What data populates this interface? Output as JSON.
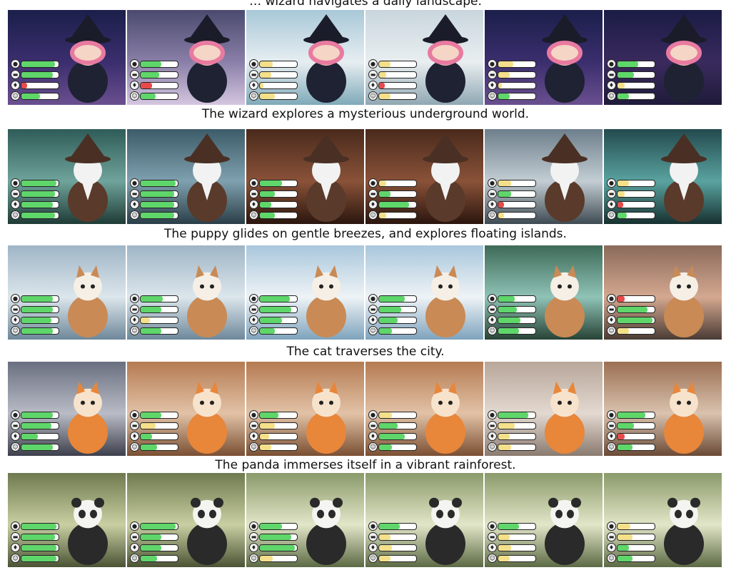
{
  "captions": [
    "… wizard navigates a daily landscape.",
    "The wizard explores a mysterious underground world.",
    "The puppy glides on gentle breezes, and explores floating islands.",
    "The cat traverses the city.",
    "The panda immerses itself in a vibrant rainforest."
  ],
  "stat_icons": [
    "food-icon",
    "energy-icon",
    "health-icon",
    "mood-icon"
  ],
  "stat_glyphs": [
    "●",
    "▬",
    "♦",
    "☺"
  ],
  "colors": {
    "high": "#5fd66a",
    "low_yellow": "#f4e08a",
    "low_red": "#e84a4a"
  },
  "rows": [
    {
      "subject": "witch",
      "scenes": [
        "starry-night",
        "misty-forest",
        "waterfall-castle",
        "mountain-lake",
        "starry-night",
        "halloween-night"
      ],
      "stats": [
        [
          {
            "v": 0.9,
            "c": "high"
          },
          {
            "v": 0.85,
            "c": "high"
          },
          {
            "v": 0.15,
            "c": "low_red"
          },
          {
            "v": 0.5,
            "c": "high"
          }
        ],
        [
          {
            "v": 0.55,
            "c": "high"
          },
          {
            "v": 0.5,
            "c": "high"
          },
          {
            "v": 0.3,
            "c": "low_red"
          },
          {
            "v": 0.4,
            "c": "high"
          }
        ],
        [
          {
            "v": 0.35,
            "c": "low_yellow"
          },
          {
            "v": 0.3,
            "c": "low_yellow"
          },
          {
            "v": 0.1,
            "c": "low_yellow"
          },
          {
            "v": 0.4,
            "c": "low_yellow"
          }
        ],
        [
          {
            "v": 0.3,
            "c": "low_yellow"
          },
          {
            "v": 0.2,
            "c": "low_yellow"
          },
          {
            "v": 0.15,
            "c": "low_red"
          },
          {
            "v": 0.3,
            "c": "low_yellow"
          }
        ],
        [
          {
            "v": 0.4,
            "c": "low_yellow"
          },
          {
            "v": 0.3,
            "c": "low_yellow"
          },
          {
            "v": 0.1,
            "c": "low_yellow"
          },
          {
            "v": 0.3,
            "c": "high"
          }
        ],
        [
          {
            "v": 0.55,
            "c": "high"
          },
          {
            "v": 0.45,
            "c": "high"
          },
          {
            "v": 0.2,
            "c": "low_yellow"
          },
          {
            "v": 0.3,
            "c": "high"
          }
        ]
      ]
    },
    {
      "subject": "old-wizard",
      "scenes": [
        "forest-cliff",
        "twilight-forest",
        "cave-tunnel",
        "cave-tunnel",
        "castle-night",
        "glowing-forest"
      ],
      "stats": [
        [
          {
            "v": 0.95,
            "c": "high"
          },
          {
            "v": 0.9,
            "c": "high"
          },
          {
            "v": 0.85,
            "c": "high"
          },
          {
            "v": 0.9,
            "c": "high"
          }
        ],
        [
          {
            "v": 0.95,
            "c": "high"
          },
          {
            "v": 0.9,
            "c": "high"
          },
          {
            "v": 0.9,
            "c": "high"
          },
          {
            "v": 0.9,
            "c": "high"
          }
        ],
        [
          {
            "v": 0.6,
            "c": "high"
          },
          {
            "v": 0.4,
            "c": "high"
          },
          {
            "v": 0.3,
            "c": "high"
          },
          {
            "v": 0.4,
            "c": "high"
          }
        ],
        [
          {
            "v": 0.2,
            "c": "low_yellow"
          },
          {
            "v": 0.3,
            "c": "high"
          },
          {
            "v": 0.8,
            "c": "high"
          },
          {
            "v": 0.2,
            "c": "low_yellow"
          }
        ],
        [
          {
            "v": 0.35,
            "c": "low_yellow"
          },
          {
            "v": 0.35,
            "c": "high"
          },
          {
            "v": 0.15,
            "c": "low_red"
          },
          {
            "v": 0.15,
            "c": "low_yellow"
          }
        ],
        [
          {
            "v": 0.3,
            "c": "low_yellow"
          },
          {
            "v": 0.2,
            "c": "low_yellow"
          },
          {
            "v": 0.15,
            "c": "low_red"
          },
          {
            "v": 0.25,
            "c": "high"
          }
        ]
      ]
    },
    {
      "subject": "puppy",
      "scenes": [
        "sky-platform",
        "sky-platform",
        "cloud-sky",
        "cloud-sky",
        "waterfall-lake",
        "sunset-house"
      ],
      "stats": [
        [
          {
            "v": 0.85,
            "c": "high"
          },
          {
            "v": 0.85,
            "c": "high"
          },
          {
            "v": 0.8,
            "c": "high"
          },
          {
            "v": 0.85,
            "c": "high"
          }
        ],
        [
          {
            "v": 0.6,
            "c": "high"
          },
          {
            "v": 0.55,
            "c": "high"
          },
          {
            "v": 0.25,
            "c": "low_yellow"
          },
          {
            "v": 0.55,
            "c": "high"
          }
        ],
        [
          {
            "v": 0.8,
            "c": "high"
          },
          {
            "v": 0.85,
            "c": "high"
          },
          {
            "v": 0.6,
            "c": "high"
          },
          {
            "v": 0.4,
            "c": "high"
          }
        ],
        [
          {
            "v": 0.7,
            "c": "high"
          },
          {
            "v": 0.6,
            "c": "high"
          },
          {
            "v": 0.5,
            "c": "high"
          },
          {
            "v": 0.35,
            "c": "high"
          }
        ],
        [
          {
            "v": 0.45,
            "c": "high"
          },
          {
            "v": 0.5,
            "c": "high"
          },
          {
            "v": 0.6,
            "c": "high"
          },
          {
            "v": 0.55,
            "c": "high"
          }
        ],
        [
          {
            "v": 0.2,
            "c": "low_red"
          },
          {
            "v": 0.8,
            "c": "high"
          },
          {
            "v": 0.95,
            "c": "high"
          },
          {
            "v": 0.3,
            "c": "low_yellow"
          }
        ]
      ]
    },
    {
      "subject": "cat",
      "scenes": [
        "city-night",
        "alley-wall",
        "alley-wall",
        "alley-wall",
        "plain-room",
        "arch-room"
      ],
      "stats": [
        [
          {
            "v": 0.85,
            "c": "high"
          },
          {
            "v": 0.8,
            "c": "high"
          },
          {
            "v": 0.45,
            "c": "high"
          },
          {
            "v": 0.85,
            "c": "high"
          }
        ],
        [
          {
            "v": 0.55,
            "c": "high"
          },
          {
            "v": 0.4,
            "c": "low_yellow"
          },
          {
            "v": 0.3,
            "c": "high"
          },
          {
            "v": 0.45,
            "c": "high"
          }
        ],
        [
          {
            "v": 0.5,
            "c": "high"
          },
          {
            "v": 0.4,
            "c": "low_yellow"
          },
          {
            "v": 0.25,
            "c": "low_yellow"
          },
          {
            "v": 0.3,
            "c": "low_yellow"
          }
        ],
        [
          {
            "v": 0.35,
            "c": "low_yellow"
          },
          {
            "v": 0.5,
            "c": "high"
          },
          {
            "v": 0.7,
            "c": "high"
          },
          {
            "v": 0.35,
            "c": "high"
          }
        ],
        [
          {
            "v": 0.8,
            "c": "high"
          },
          {
            "v": 0.45,
            "c": "low_yellow"
          },
          {
            "v": 0.3,
            "c": "low_yellow"
          },
          {
            "v": 0.35,
            "c": "low_yellow"
          }
        ],
        [
          {
            "v": 0.75,
            "c": "high"
          },
          {
            "v": 0.45,
            "c": "high"
          },
          {
            "v": 0.2,
            "c": "low_red"
          },
          {
            "v": 0.4,
            "c": "high"
          }
        ]
      ]
    },
    {
      "subject": "panda",
      "scenes": [
        "rainforest",
        "rainforest",
        "jungle-light",
        "jungle-light",
        "jungle-light",
        "jungle-light"
      ],
      "stats": [
        [
          {
            "v": 0.95,
            "c": "high"
          },
          {
            "v": 0.9,
            "c": "high"
          },
          {
            "v": 0.95,
            "c": "high"
          },
          {
            "v": 0.95,
            "c": "high"
          }
        ],
        [
          {
            "v": 0.95,
            "c": "high"
          },
          {
            "v": 0.55,
            "c": "high"
          },
          {
            "v": 0.55,
            "c": "high"
          },
          {
            "v": 0.45,
            "c": "high"
          }
        ],
        [
          {
            "v": 0.6,
            "c": "high"
          },
          {
            "v": 0.85,
            "c": "high"
          },
          {
            "v": 0.95,
            "c": "high"
          },
          {
            "v": 0.35,
            "c": "low_yellow"
          }
        ],
        [
          {
            "v": 0.55,
            "c": "high"
          },
          {
            "v": 0.3,
            "c": "low_yellow"
          },
          {
            "v": 0.35,
            "c": "low_yellow"
          },
          {
            "v": 0.3,
            "c": "low_yellow"
          }
        ],
        [
          {
            "v": 0.55,
            "c": "high"
          },
          {
            "v": 0.3,
            "c": "low_yellow"
          },
          {
            "v": 0.35,
            "c": "low_yellow"
          },
          {
            "v": 0.3,
            "c": "low_yellow"
          }
        ],
        [
          {
            "v": 0.35,
            "c": "low_yellow"
          },
          {
            "v": 0.4,
            "c": "low_yellow"
          },
          {
            "v": 0.3,
            "c": "high"
          },
          {
            "v": 0.4,
            "c": "high"
          }
        ]
      ]
    }
  ]
}
